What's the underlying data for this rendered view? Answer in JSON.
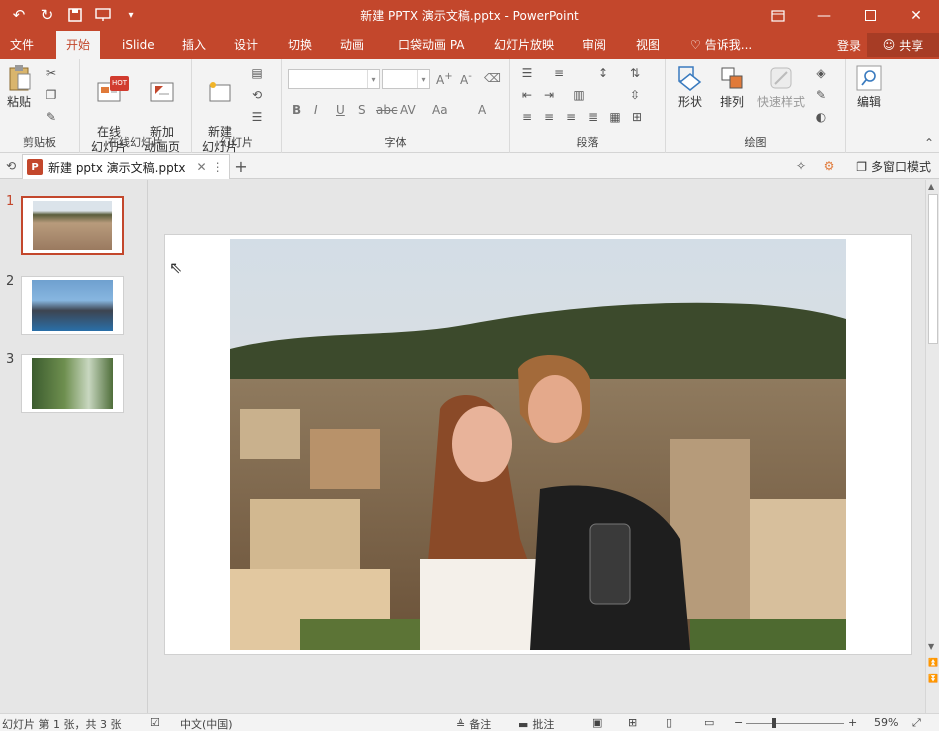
{
  "window": {
    "title": "新建 PPTX 演示文稿.pptx - PowerPoint",
    "accent": "#c3472c"
  },
  "ribbon_tabs": [
    "文件",
    "开始",
    "iSlide",
    "插入",
    "设计",
    "切换",
    "动画",
    "口袋动画 PA",
    "幻灯片放映",
    "审阅",
    "视图"
  ],
  "tell_me": "告诉我...",
  "signin": "登录",
  "share": "共享",
  "groups": {
    "clipboard": {
      "label": "剪贴板",
      "paste": "粘贴"
    },
    "online_slides": {
      "label": "在线幻灯片",
      "online": "在线\n幻灯片",
      "new_anim": "新加\n动画页",
      "hot": "HOT"
    },
    "slides": {
      "label": "幻灯片",
      "new_slide": "新建\n幻灯片"
    },
    "font": {
      "label": "字体"
    },
    "paragraph": {
      "label": "段落"
    },
    "drawing": {
      "label": "绘图",
      "shapes": "形状",
      "arrange": "排列",
      "quick_styles": "快速样式"
    },
    "editing": {
      "label": "编辑"
    }
  },
  "document_tab": {
    "name": "新建 pptx 演示文稿.pptx",
    "multiwindow": "多窗口模式"
  },
  "slides": [
    {
      "number": "1",
      "selected": true
    },
    {
      "number": "2",
      "selected": false
    },
    {
      "number": "3",
      "selected": false
    }
  ],
  "status": {
    "slide_info": "幻灯片 第 1 张，共 3 张",
    "language": "中文(中国)",
    "notes": "备注",
    "comments": "批注",
    "zoom": "59%"
  }
}
